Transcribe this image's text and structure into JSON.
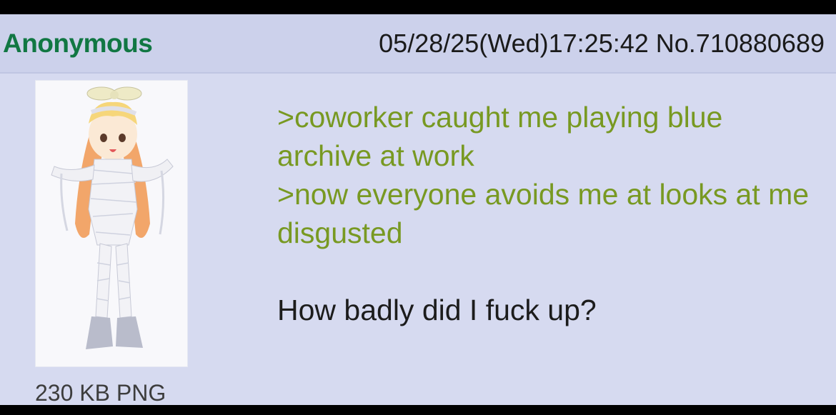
{
  "post": {
    "name": "Anonymous",
    "datetime": "05/28/25(Wed)17:25:42",
    "number": "No.710880689",
    "file_info": "230 KB PNG",
    "thumbnail_icon": "image-thumbnail",
    "comment": {
      "quote_lines": [
        ">coworker caught me playing blue archive at work",
        ">now everyone avoids me at looks at me disgusted"
      ],
      "text": "How badly did I fuck up?"
    }
  },
  "colors": {
    "background": "#d6daf0",
    "header": "#ccd1eb",
    "name": "#117743",
    "greentext": "#789922"
  }
}
